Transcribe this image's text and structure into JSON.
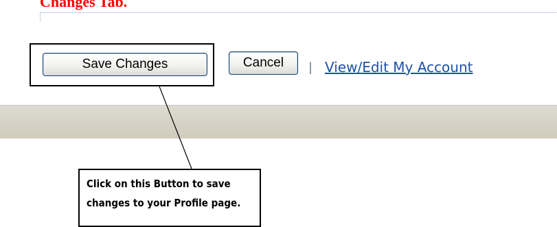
{
  "page": {
    "heading_fragment": "Changes Tab.",
    "heading_color": "#ff0000"
  },
  "form_actions": {
    "save_label": "Save Changes",
    "cancel_label": "Cancel",
    "separator": "|",
    "account_link_label": "View/Edit My Account",
    "link_color": "#1d4fa6"
  },
  "callout": {
    "note_text": "Click on this Button to save changes to your Profile page."
  },
  "colors": {
    "footer_band": "#d8d4c8",
    "button_border": "#1e3f6b"
  }
}
